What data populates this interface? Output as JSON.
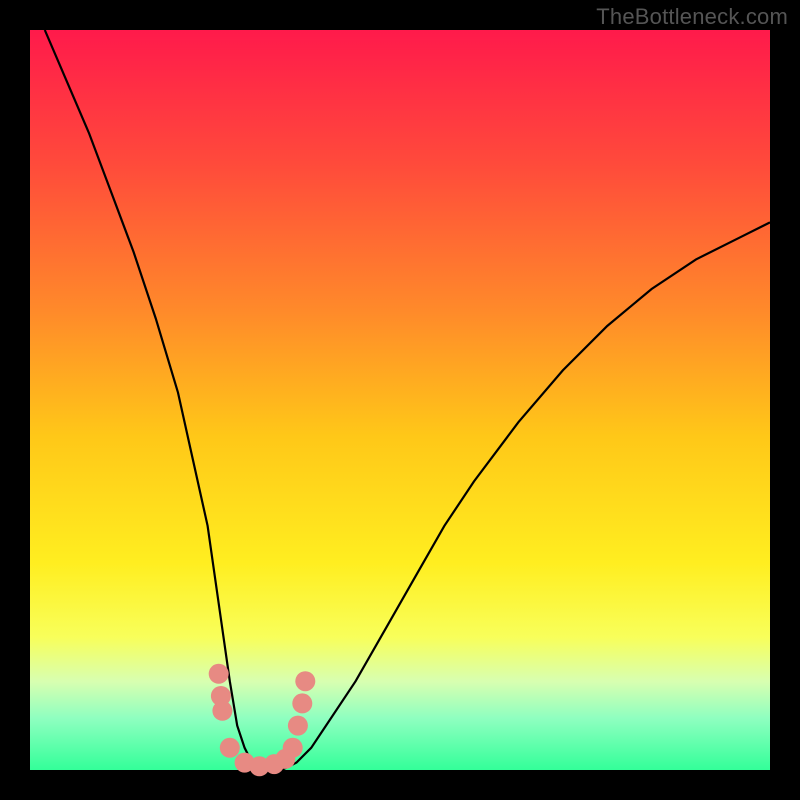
{
  "watermark": {
    "text": "TheBottleneck.com"
  },
  "gradient": {
    "stops": [
      {
        "pct": 0,
        "color": "#ff1a4b"
      },
      {
        "pct": 18,
        "color": "#ff4a3b"
      },
      {
        "pct": 38,
        "color": "#ff8a2a"
      },
      {
        "pct": 55,
        "color": "#ffc818"
      },
      {
        "pct": 72,
        "color": "#ffee20"
      },
      {
        "pct": 82,
        "color": "#f8ff5a"
      },
      {
        "pct": 88,
        "color": "#d8ffb0"
      },
      {
        "pct": 93,
        "color": "#8fffc0"
      },
      {
        "pct": 100,
        "color": "#33ff99"
      }
    ]
  },
  "chart_data": {
    "type": "line",
    "title": "",
    "xlabel": "",
    "ylabel": "",
    "xlim": [
      0,
      100
    ],
    "ylim": [
      0,
      100
    ],
    "curve": {
      "x": [
        2,
        5,
        8,
        11,
        14,
        17,
        20,
        22,
        24,
        25,
        26,
        27,
        28,
        29,
        30,
        32,
        34,
        36,
        38,
        40,
        44,
        48,
        52,
        56,
        60,
        66,
        72,
        78,
        84,
        90,
        96,
        100
      ],
      "y": [
        100,
        93,
        86,
        78,
        70,
        61,
        51,
        42,
        33,
        26,
        19,
        12,
        6,
        3,
        1,
        0,
        0,
        1,
        3,
        6,
        12,
        19,
        26,
        33,
        39,
        47,
        54,
        60,
        65,
        69,
        72,
        74
      ]
    },
    "markers": {
      "x": [
        25.5,
        25.8,
        26.0,
        27.0,
        29.0,
        31.0,
        33.0,
        34.5,
        35.5,
        36.2,
        36.8,
        37.2
      ],
      "y": [
        13.0,
        10.0,
        8.0,
        3.0,
        1.0,
        0.5,
        0.8,
        1.5,
        3.0,
        6.0,
        9.0,
        12.0
      ],
      "radius_px": 10
    }
  }
}
